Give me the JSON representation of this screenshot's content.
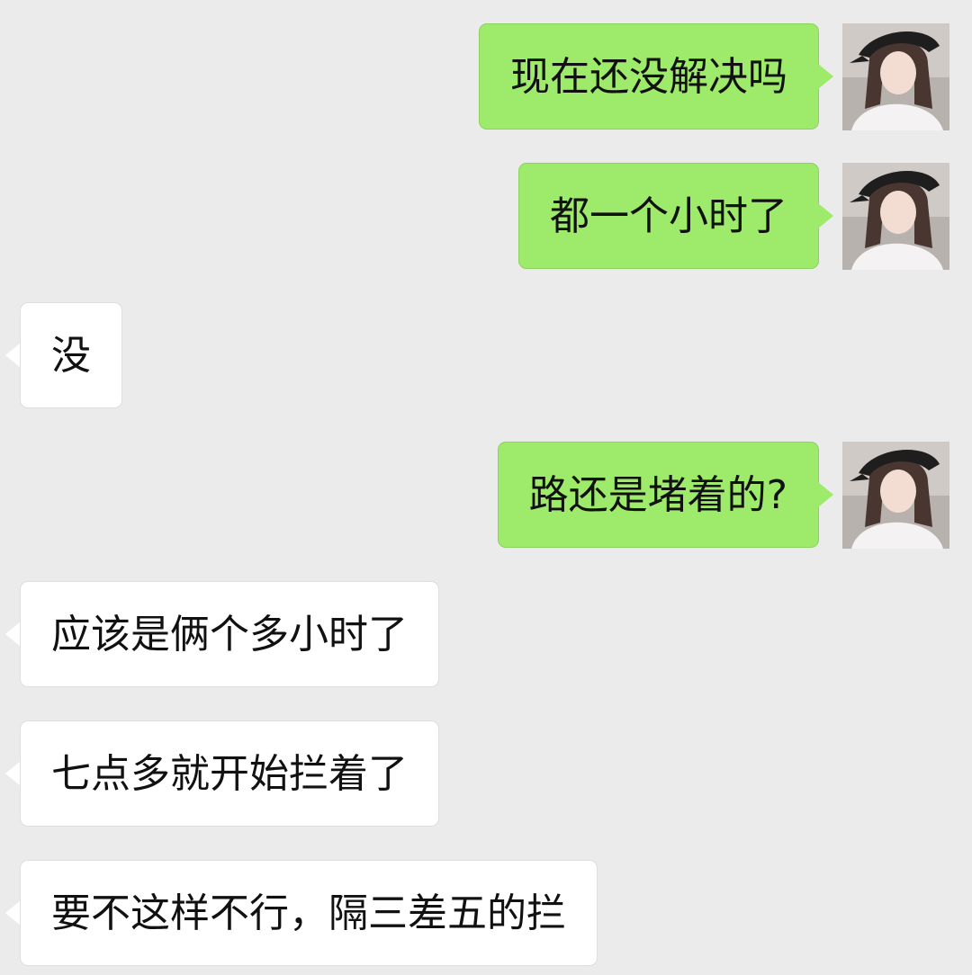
{
  "conversation": {
    "messages": [
      {
        "direction": "outgoing",
        "text": "现在还没解决吗",
        "avatar": "user-avatar"
      },
      {
        "direction": "outgoing",
        "text": "都一个小时了",
        "avatar": "user-avatar"
      },
      {
        "direction": "incoming",
        "text": "没"
      },
      {
        "direction": "outgoing",
        "text": "路还是堵着的?",
        "avatar": "user-avatar"
      },
      {
        "direction": "incoming",
        "text": "应该是俩个多小时了"
      },
      {
        "direction": "incoming",
        "text": "七点多就开始拦着了"
      },
      {
        "direction": "incoming",
        "text": "要不这样不行，隔三差五的拦"
      }
    ]
  },
  "colors": {
    "background": "#ebebeb",
    "outgoing_bubble": "#9eea6a",
    "incoming_bubble": "#ffffff",
    "text": "#111111"
  }
}
